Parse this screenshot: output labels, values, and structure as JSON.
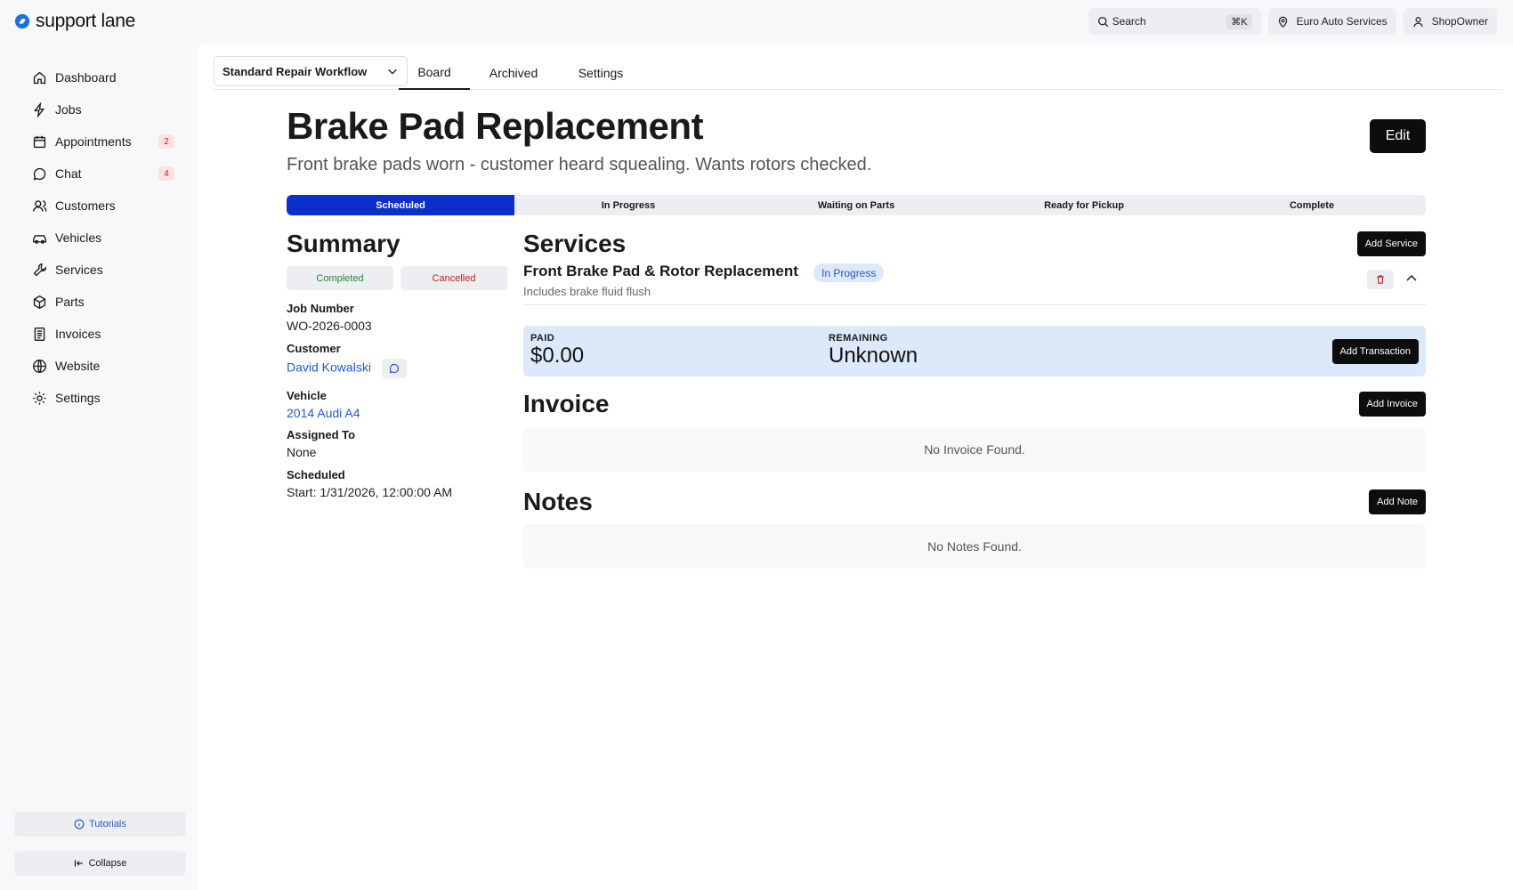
{
  "brand": {
    "name": "support lane"
  },
  "topbar": {
    "search_label": "Search",
    "search_shortcut": "⌘K",
    "location": "Euro Auto Services",
    "user": "ShopOwner"
  },
  "sidebar": {
    "items": [
      {
        "label": "Dashboard",
        "icon": "home-icon"
      },
      {
        "label": "Jobs",
        "icon": "bolt-icon"
      },
      {
        "label": "Appointments",
        "icon": "calendar-icon",
        "badge": "2"
      },
      {
        "label": "Chat",
        "icon": "chat-icon",
        "badge": "4"
      },
      {
        "label": "Customers",
        "icon": "users-icon"
      },
      {
        "label": "Vehicles",
        "icon": "car-icon"
      },
      {
        "label": "Services",
        "icon": "wrench-icon"
      },
      {
        "label": "Parts",
        "icon": "box-icon"
      },
      {
        "label": "Invoices",
        "icon": "receipt-icon"
      },
      {
        "label": "Website",
        "icon": "globe-icon"
      },
      {
        "label": "Settings",
        "icon": "gear-icon"
      }
    ],
    "tutorials_label": "Tutorials",
    "collapse_label": "Collapse"
  },
  "tabs": {
    "workflow": "Standard Repair Workflow",
    "items": [
      "Board",
      "Archived",
      "Settings"
    ],
    "active": "Board"
  },
  "job": {
    "title": "Brake Pad Replacement",
    "subtitle": "Front brake pads worn - customer heard squealing. Wants rotors checked.",
    "edit_label": "Edit",
    "steps": [
      "Scheduled",
      "In Progress",
      "Waiting on Parts",
      "Ready for Pickup",
      "Complete"
    ],
    "active_step": "Scheduled"
  },
  "summary": {
    "title": "Summary",
    "completed_label": "Completed",
    "cancelled_label": "Cancelled",
    "job_number_label": "Job Number",
    "job_number": "WO-2026-0003",
    "customer_label": "Customer",
    "customer": "David Kowalski",
    "vehicle_label": "Vehicle",
    "vehicle": "2014 Audi A4",
    "assigned_label": "Assigned To",
    "assigned": "None",
    "scheduled_label": "Scheduled",
    "scheduled": "Start: 1/31/2026, 12:00:00 AM"
  },
  "services": {
    "title": "Services",
    "add_label": "Add Service",
    "item": {
      "name": "Front Brake Pad & Rotor Replacement",
      "status": "In Progress",
      "description": "Includes brake fluid flush"
    }
  },
  "payment": {
    "paid_label": "PAID",
    "paid_value": "$0.00",
    "remaining_label": "REMAINING",
    "remaining_value": "Unknown",
    "add_label": "Add Transaction"
  },
  "invoice": {
    "title": "Invoice",
    "add_label": "Add Invoice",
    "empty": "No Invoice Found."
  },
  "notes": {
    "title": "Notes",
    "add_label": "Add Note",
    "empty": "No Notes Found."
  },
  "colors": {
    "accent": "#0c2fcb",
    "link": "#2458c6",
    "badge_bg": "#fde2e2",
    "badge_text": "#c52020",
    "payment_bg": "#dce9fa"
  }
}
